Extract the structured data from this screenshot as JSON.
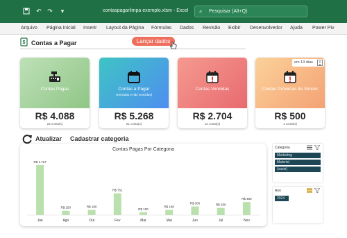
{
  "window": {
    "file_title": "contaspagarlimpa exemplo.xlsm  -  Excel",
    "search_placeholder": "Pesquisar (Alt+Q)",
    "titlebar_icons": [
      "save-icon",
      "undo-icon",
      "redo-icon",
      "customize-icon"
    ]
  },
  "menu": {
    "items": [
      "Arquivo",
      "Página Inicial",
      "Inserir",
      "Layout da Página",
      "Fórmulas",
      "Dados",
      "Revisão",
      "Exibir",
      "Desenvolvedor",
      "Ajuda",
      "Power Piv"
    ]
  },
  "header": {
    "title": "Contas a Pagar",
    "action_button": "Lançar dados"
  },
  "cards": [
    {
      "label": "Contas Pagas",
      "sub": "",
      "value": "R$ 4.088",
      "count": "22 conta(s)",
      "icon": "cash-register-icon"
    },
    {
      "label": "Contas a Pagar",
      "sub": "(vencidas e não vencidas)",
      "value": "R$ 5.268",
      "count": "21 conta(s)",
      "icon": "calendar-icon"
    },
    {
      "label": "Contas Vencidas",
      "sub": "",
      "value": "R$ 2.704",
      "count": "12 conta(s)",
      "icon": "calendar-alert-icon"
    },
    {
      "label": "Contas Próximas de Vencer",
      "sub": "",
      "value": "R$ 500",
      "count": "1 conta(s)",
      "icon": "calendar-alert-icon",
      "days_label": "em 13 dias"
    }
  ],
  "actions": {
    "update": "Atualizar",
    "register_category": "Cadastrar categoria"
  },
  "chart_data": {
    "type": "bar",
    "title": "Contas Pagas Por Categoria",
    "categories": [
      "Jan",
      "Ago",
      "Out",
      "Fev",
      "Mar",
      "Mai",
      "Jun",
      "Jul",
      "Nov"
    ],
    "values": [
      1727,
      150,
      180,
      751,
      100,
      180,
      300,
      250,
      450
    ],
    "data_labels": [
      "R$ 1.727",
      "R$ 150",
      "R$ 180",
      "R$ 751",
      "R$ 100",
      "R$ 180",
      "R$ 300",
      "R$ 250",
      "R$ 450"
    ],
    "bar_color": "#b9e0ad",
    "ylim": [
      0,
      1727
    ],
    "grid": false,
    "legend": false
  },
  "slicers": {
    "category": {
      "header": "Categoria",
      "items": [
        "Marketing",
        "Material",
        "(vazio)"
      ]
    },
    "year": {
      "header": "Ano",
      "items": [
        "2024"
      ]
    }
  },
  "colors": {
    "excel_green": "#1f7145",
    "slicer_item": "#1e4756",
    "action_button": "#ee6f5e"
  }
}
